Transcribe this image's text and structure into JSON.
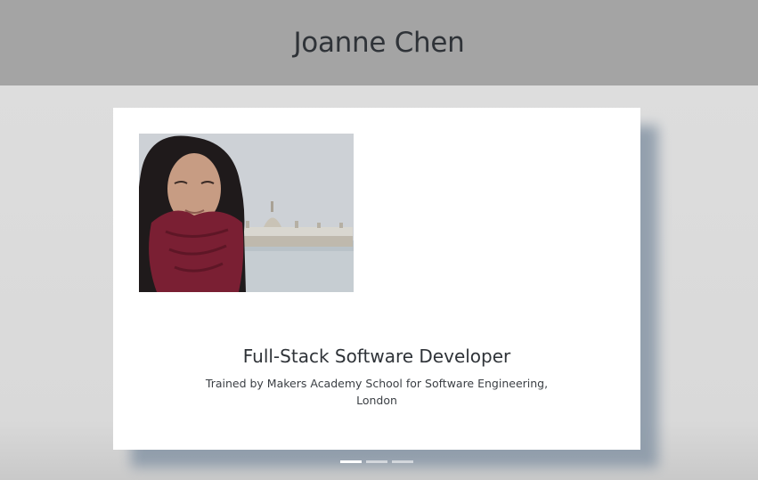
{
  "header": {
    "name": "Joanne Chen"
  },
  "slide": {
    "photo_alt": "Photo of Joanne Chen by a river with a parliament building",
    "title": "Full-Stack Software Developer",
    "subtitle": "Trained by Makers Academy School for Software Engineering, London"
  },
  "carousel": {
    "slide_count": 3,
    "active_index": 0
  },
  "colors": {
    "header_bg": "#a4a4a4",
    "page_bg": "#dcdcdc",
    "card_shadow": "#8796a6",
    "text": "#2f3338"
  }
}
